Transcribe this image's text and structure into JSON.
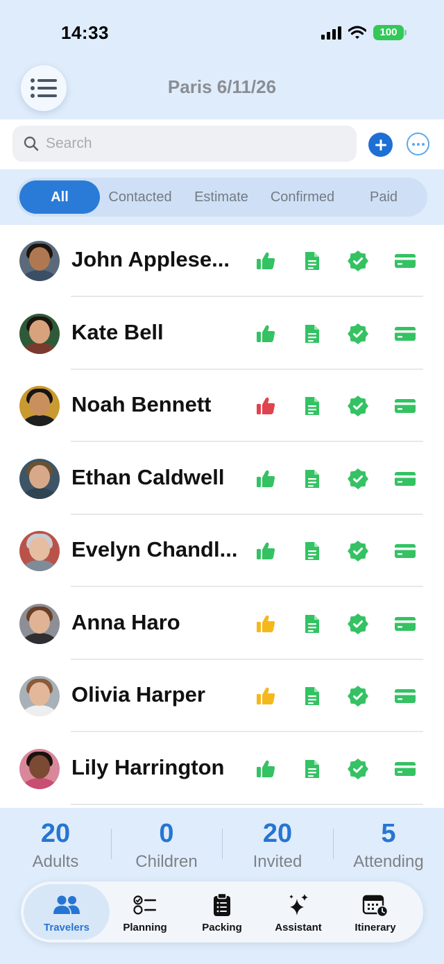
{
  "status_bar": {
    "time": "14:33",
    "battery": "100"
  },
  "header": {
    "title": "Paris 6/11/26"
  },
  "search": {
    "placeholder": "Search",
    "value": ""
  },
  "filters": [
    {
      "label": "All",
      "active": true
    },
    {
      "label": "Contacted",
      "active": false
    },
    {
      "label": "Estimate",
      "active": false
    },
    {
      "label": "Confirmed",
      "active": false
    },
    {
      "label": "Paid",
      "active": false
    }
  ],
  "colors": {
    "green": "#34c263",
    "red": "#e0434e",
    "yellow": "#f5b81c",
    "accent": "#2675d2"
  },
  "travelers": [
    {
      "name": "John Applese...",
      "contacted": "green"
    },
    {
      "name": "Kate Bell",
      "contacted": "green"
    },
    {
      "name": "Noah Bennett",
      "contacted": "red"
    },
    {
      "name": "Ethan Caldwell",
      "contacted": "green"
    },
    {
      "name": "Evelyn Chandl...",
      "contacted": "green"
    },
    {
      "name": "Anna Haro",
      "contacted": "yellow"
    },
    {
      "name": "Olivia Harper",
      "contacted": "yellow"
    },
    {
      "name": "Lily Harrington",
      "contacted": "green"
    }
  ],
  "summary": {
    "adults": {
      "value": "20",
      "label": "Adults"
    },
    "children": {
      "value": "0",
      "label": "Children"
    },
    "invited": {
      "value": "20",
      "label": "Invited"
    },
    "attending": {
      "value": "5",
      "label": "Attending"
    }
  },
  "tabbar": [
    {
      "label": "Travelers",
      "icon": "people-icon",
      "active": true
    },
    {
      "label": "Planning",
      "icon": "checklist-icon",
      "active": false
    },
    {
      "label": "Packing",
      "icon": "clipboard-icon",
      "active": false
    },
    {
      "label": "Assistant",
      "icon": "sparkles-icon",
      "active": false
    },
    {
      "label": "Itinerary",
      "icon": "calendar-clock-icon",
      "active": false
    }
  ]
}
